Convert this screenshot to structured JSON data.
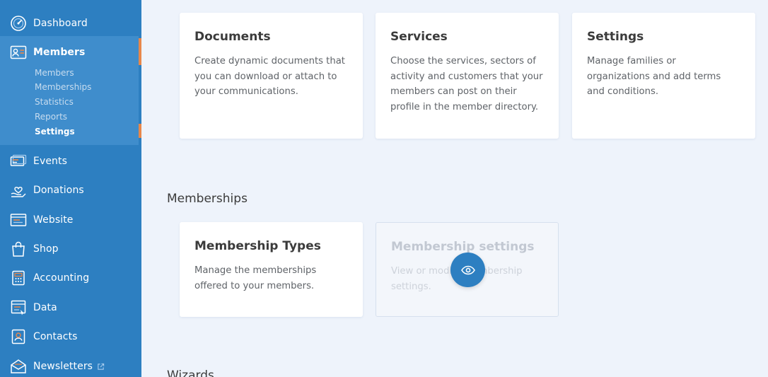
{
  "sidebar": {
    "items": [
      {
        "label": "Dashboard",
        "icon": "dashboard-icon"
      },
      {
        "label": "Members",
        "icon": "members-icon"
      },
      {
        "label": "Events",
        "icon": "events-icon"
      },
      {
        "label": "Donations",
        "icon": "donations-icon"
      },
      {
        "label": "Website",
        "icon": "website-icon"
      },
      {
        "label": "Shop",
        "icon": "shop-icon"
      },
      {
        "label": "Accounting",
        "icon": "accounting-icon"
      },
      {
        "label": "Data",
        "icon": "data-icon"
      },
      {
        "label": "Contacts",
        "icon": "contacts-icon"
      },
      {
        "label": "Newsletters",
        "icon": "newsletters-icon"
      }
    ],
    "members_sub": [
      "Members",
      "Memberships",
      "Statistics",
      "Reports",
      "Settings"
    ],
    "active_sub": "Settings",
    "accent_color": "#e8874a",
    "bg_color": "#2d7fc1"
  },
  "main": {
    "top_cards": [
      {
        "title": "Documents",
        "desc": "Create dynamic documents that you can download or attach to your communications."
      },
      {
        "title": "Services",
        "desc": "Choose the services, sectors of activity and customers that your members can post on their profile in the member directory."
      },
      {
        "title": "Settings",
        "desc": "Manage families or organizations and add terms and conditions."
      }
    ],
    "memberships_section": {
      "title": "Memberships",
      "cards": [
        {
          "title": "Membership Types",
          "desc": "Manage the memberships offered to your members."
        },
        {
          "title": "Membership settings",
          "desc": "View or modify membership settings."
        }
      ],
      "overlay_icon": "eye-icon"
    },
    "wizards_section": {
      "title": "Wizards"
    }
  }
}
